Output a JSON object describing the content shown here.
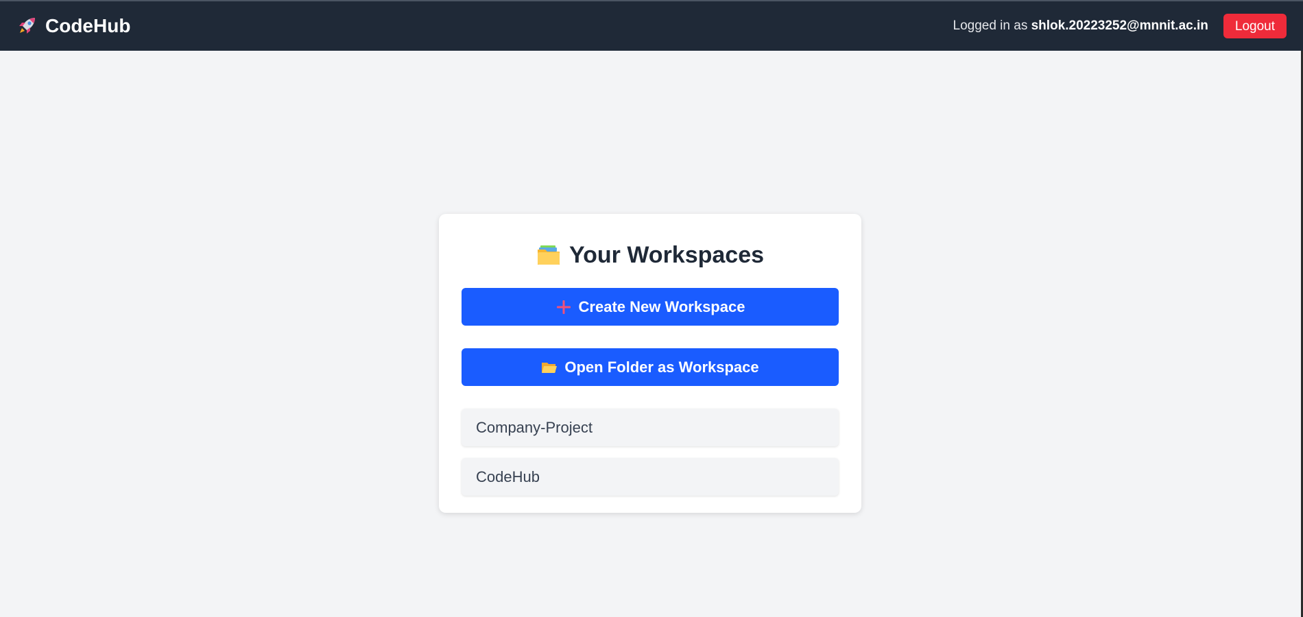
{
  "app": {
    "name": "CodeHub",
    "logo_icon": "rocket-icon"
  },
  "header": {
    "logged_in_prefix": "Logged in as",
    "user_email": "shlok.20223252@mnnit.ac.in",
    "logout_label": "Logout",
    "logout_color": "#ef2b3a",
    "background": "#1f2937"
  },
  "workspaces_panel": {
    "title": "Your Workspaces",
    "title_icon": "folder-icon",
    "create_button_label": "Create New Workspace",
    "create_button_icon": "plus-icon",
    "open_folder_button_label": "Open Folder as Workspace",
    "open_folder_button_icon": "open-folder-icon",
    "button_color": "#1a5cff",
    "items": [
      {
        "label": "Company-Project"
      },
      {
        "label": "CodeHub"
      }
    ]
  }
}
